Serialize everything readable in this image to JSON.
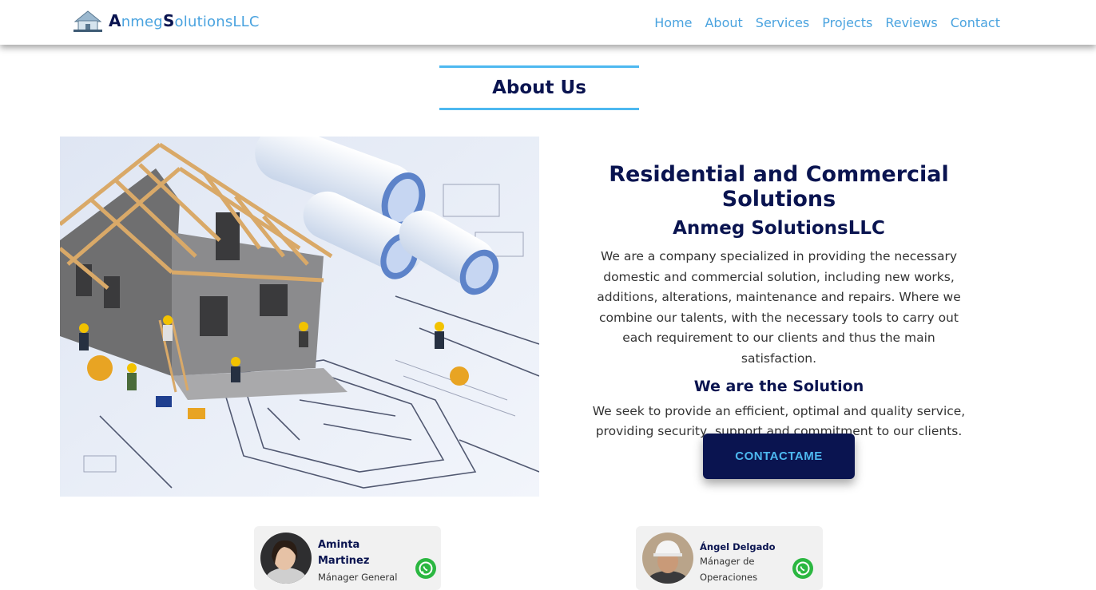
{
  "header": {
    "logo_initial_1": "A",
    "logo_text_1": "nmeg",
    "logo_initial_2": "S",
    "logo_text_2": "olutionsLLC",
    "nav": [
      "Home",
      "About",
      "Services",
      "Projects",
      "Reviews",
      "Contact"
    ]
  },
  "about": {
    "title": "About Us",
    "heading": "Residential and Commercial Solutions",
    "company": "Anmeg SolutionsLLC",
    "description": "We are a company specialized in providing the necessary domestic and commercial solution, including new works, additions, alterations, maintenance and repairs. Where we combine our talents, with the necessary tools to carry out each requirement to our clients and thus the main satisfaction.",
    "subheading": "We are the Solution",
    "mission": "We seek to provide an efficient, optimal and quality service, providing security, support and commitment to our clients.",
    "button": "CONTACTAME"
  },
  "team": [
    {
      "name_line1": "Aminta",
      "name_line2": "Martinez",
      "role": "Mánager General"
    },
    {
      "name": "Ángel Delgado",
      "role_line1": "Mánager de",
      "role_line2": "Operaciones"
    }
  ],
  "colors": {
    "navy": "#0a1450",
    "accent": "#4aa3df",
    "whatsapp": "#2bb741"
  }
}
